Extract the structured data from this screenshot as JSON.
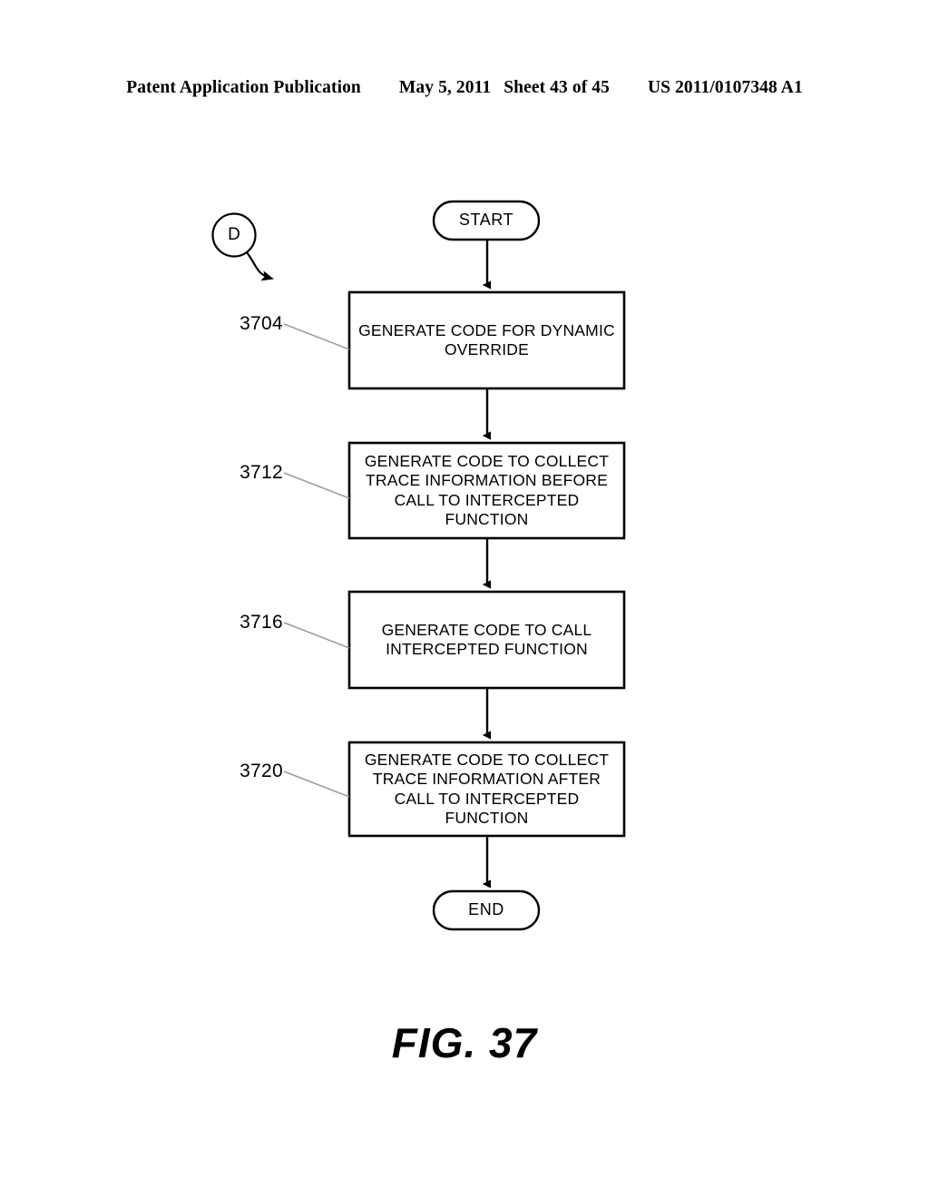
{
  "header": {
    "publication": "Patent Application Publication",
    "date": "May 5, 2011",
    "sheet": "Sheet 43 of 45",
    "patent_number": "US 2011/0107348 A1"
  },
  "figure": {
    "caption": "FIG. 37",
    "off_page_connector": "D"
  },
  "flowchart": {
    "type": "flowchart",
    "start": {
      "label": "START",
      "shape": "terminator"
    },
    "end": {
      "label": "END",
      "shape": "terminator"
    },
    "steps": [
      {
        "ref": "3704",
        "label": "GENERATE CODE FOR DYNAMIC OVERRIDE",
        "lines": [
          "GENERATE CODE FOR DYNAMIC",
          "OVERRIDE"
        ],
        "shape": "process"
      },
      {
        "ref": "3712",
        "label": "GENERATE CODE TO COLLECT TRACE INFORMATION BEFORE CALL TO INTERCEPTED FUNCTION",
        "lines": [
          "GENERATE CODE TO COLLECT",
          "TRACE INFORMATION BEFORE",
          "CALL TO INTERCEPTED",
          "FUNCTION"
        ],
        "shape": "process"
      },
      {
        "ref": "3716",
        "label": "GENERATE CODE TO CALL INTERCEPTED FUNCTION",
        "lines": [
          "GENERATE CODE TO CALL",
          "INTERCEPTED FUNCTION"
        ],
        "shape": "process"
      },
      {
        "ref": "3720",
        "label": "GENERATE CODE TO COLLECT TRACE INFORMATION AFTER CALL TO INTERCEPTED FUNCTION",
        "lines": [
          "GENERATE CODE TO COLLECT",
          "TRACE INFORMATION AFTER",
          "CALL TO INTERCEPTED",
          "FUNCTION"
        ],
        "shape": "process"
      }
    ]
  },
  "colors": {
    "ink": "#000000",
    "paper": "#ffffff",
    "leader": "#9a9a9a"
  }
}
